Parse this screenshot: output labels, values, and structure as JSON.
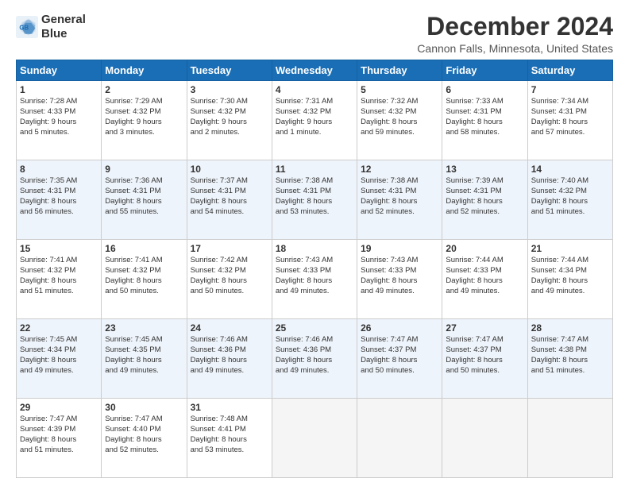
{
  "logo": {
    "line1": "General",
    "line2": "Blue"
  },
  "title": "December 2024",
  "location": "Cannon Falls, Minnesota, United States",
  "days_header": [
    "Sunday",
    "Monday",
    "Tuesday",
    "Wednesday",
    "Thursday",
    "Friday",
    "Saturday"
  ],
  "weeks": [
    [
      {
        "day": "1",
        "lines": [
          "Sunrise: 7:28 AM",
          "Sunset: 4:33 PM",
          "Daylight: 9 hours",
          "and 5 minutes."
        ]
      },
      {
        "day": "2",
        "lines": [
          "Sunrise: 7:29 AM",
          "Sunset: 4:32 PM",
          "Daylight: 9 hours",
          "and 3 minutes."
        ]
      },
      {
        "day": "3",
        "lines": [
          "Sunrise: 7:30 AM",
          "Sunset: 4:32 PM",
          "Daylight: 9 hours",
          "and 2 minutes."
        ]
      },
      {
        "day": "4",
        "lines": [
          "Sunrise: 7:31 AM",
          "Sunset: 4:32 PM",
          "Daylight: 9 hours",
          "and 1 minute."
        ]
      },
      {
        "day": "5",
        "lines": [
          "Sunrise: 7:32 AM",
          "Sunset: 4:32 PM",
          "Daylight: 8 hours",
          "and 59 minutes."
        ]
      },
      {
        "day": "6",
        "lines": [
          "Sunrise: 7:33 AM",
          "Sunset: 4:31 PM",
          "Daylight: 8 hours",
          "and 58 minutes."
        ]
      },
      {
        "day": "7",
        "lines": [
          "Sunrise: 7:34 AM",
          "Sunset: 4:31 PM",
          "Daylight: 8 hours",
          "and 57 minutes."
        ]
      }
    ],
    [
      {
        "day": "8",
        "lines": [
          "Sunrise: 7:35 AM",
          "Sunset: 4:31 PM",
          "Daylight: 8 hours",
          "and 56 minutes."
        ]
      },
      {
        "day": "9",
        "lines": [
          "Sunrise: 7:36 AM",
          "Sunset: 4:31 PM",
          "Daylight: 8 hours",
          "and 55 minutes."
        ]
      },
      {
        "day": "10",
        "lines": [
          "Sunrise: 7:37 AM",
          "Sunset: 4:31 PM",
          "Daylight: 8 hours",
          "and 54 minutes."
        ]
      },
      {
        "day": "11",
        "lines": [
          "Sunrise: 7:38 AM",
          "Sunset: 4:31 PM",
          "Daylight: 8 hours",
          "and 53 minutes."
        ]
      },
      {
        "day": "12",
        "lines": [
          "Sunrise: 7:38 AM",
          "Sunset: 4:31 PM",
          "Daylight: 8 hours",
          "and 52 minutes."
        ]
      },
      {
        "day": "13",
        "lines": [
          "Sunrise: 7:39 AM",
          "Sunset: 4:31 PM",
          "Daylight: 8 hours",
          "and 52 minutes."
        ]
      },
      {
        "day": "14",
        "lines": [
          "Sunrise: 7:40 AM",
          "Sunset: 4:32 PM",
          "Daylight: 8 hours",
          "and 51 minutes."
        ]
      }
    ],
    [
      {
        "day": "15",
        "lines": [
          "Sunrise: 7:41 AM",
          "Sunset: 4:32 PM",
          "Daylight: 8 hours",
          "and 51 minutes."
        ]
      },
      {
        "day": "16",
        "lines": [
          "Sunrise: 7:41 AM",
          "Sunset: 4:32 PM",
          "Daylight: 8 hours",
          "and 50 minutes."
        ]
      },
      {
        "day": "17",
        "lines": [
          "Sunrise: 7:42 AM",
          "Sunset: 4:32 PM",
          "Daylight: 8 hours",
          "and 50 minutes."
        ]
      },
      {
        "day": "18",
        "lines": [
          "Sunrise: 7:43 AM",
          "Sunset: 4:33 PM",
          "Daylight: 8 hours",
          "and 49 minutes."
        ]
      },
      {
        "day": "19",
        "lines": [
          "Sunrise: 7:43 AM",
          "Sunset: 4:33 PM",
          "Daylight: 8 hours",
          "and 49 minutes."
        ]
      },
      {
        "day": "20",
        "lines": [
          "Sunrise: 7:44 AM",
          "Sunset: 4:33 PM",
          "Daylight: 8 hours",
          "and 49 minutes."
        ]
      },
      {
        "day": "21",
        "lines": [
          "Sunrise: 7:44 AM",
          "Sunset: 4:34 PM",
          "Daylight: 8 hours",
          "and 49 minutes."
        ]
      }
    ],
    [
      {
        "day": "22",
        "lines": [
          "Sunrise: 7:45 AM",
          "Sunset: 4:34 PM",
          "Daylight: 8 hours",
          "and 49 minutes."
        ]
      },
      {
        "day": "23",
        "lines": [
          "Sunrise: 7:45 AM",
          "Sunset: 4:35 PM",
          "Daylight: 8 hours",
          "and 49 minutes."
        ]
      },
      {
        "day": "24",
        "lines": [
          "Sunrise: 7:46 AM",
          "Sunset: 4:36 PM",
          "Daylight: 8 hours",
          "and 49 minutes."
        ]
      },
      {
        "day": "25",
        "lines": [
          "Sunrise: 7:46 AM",
          "Sunset: 4:36 PM",
          "Daylight: 8 hours",
          "and 49 minutes."
        ]
      },
      {
        "day": "26",
        "lines": [
          "Sunrise: 7:47 AM",
          "Sunset: 4:37 PM",
          "Daylight: 8 hours",
          "and 50 minutes."
        ]
      },
      {
        "day": "27",
        "lines": [
          "Sunrise: 7:47 AM",
          "Sunset: 4:37 PM",
          "Daylight: 8 hours",
          "and 50 minutes."
        ]
      },
      {
        "day": "28",
        "lines": [
          "Sunrise: 7:47 AM",
          "Sunset: 4:38 PM",
          "Daylight: 8 hours",
          "and 51 minutes."
        ]
      }
    ],
    [
      {
        "day": "29",
        "lines": [
          "Sunrise: 7:47 AM",
          "Sunset: 4:39 PM",
          "Daylight: 8 hours",
          "and 51 minutes."
        ]
      },
      {
        "day": "30",
        "lines": [
          "Sunrise: 7:47 AM",
          "Sunset: 4:40 PM",
          "Daylight: 8 hours",
          "and 52 minutes."
        ]
      },
      {
        "day": "31",
        "lines": [
          "Sunrise: 7:48 AM",
          "Sunset: 4:41 PM",
          "Daylight: 8 hours",
          "and 53 minutes."
        ]
      },
      null,
      null,
      null,
      null
    ]
  ]
}
